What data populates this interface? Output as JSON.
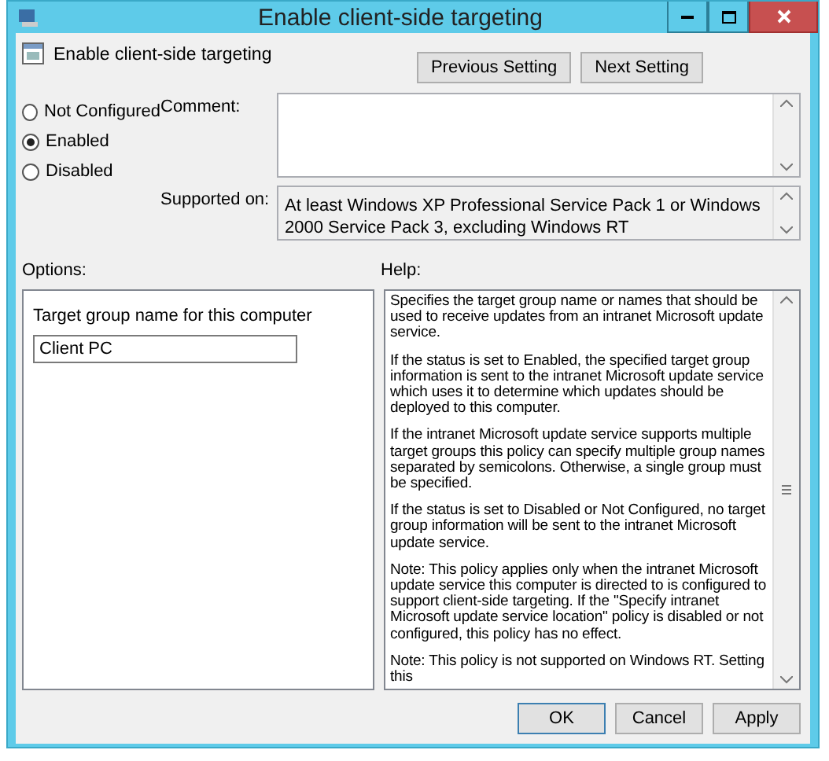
{
  "window": {
    "title": "Enable client-side targeting"
  },
  "header": {
    "title": "Enable client-side targeting",
    "buttons": [
      "Previous Setting",
      "Next Setting"
    ]
  },
  "states": [
    {
      "label": "Not Configured",
      "selected": false
    },
    {
      "label": "Enabled",
      "selected": true
    },
    {
      "label": "Disabled",
      "selected": false
    }
  ],
  "comment": {
    "label": "Comment:"
  },
  "supported_on": {
    "label": "Supported on:",
    "value": "At least Windows XP Professional Service Pack 1 or Windows 2000 Service Pack 3, excluding Windows RT"
  },
  "options": {
    "label": "Options:",
    "field_label": "Target group name for this computer",
    "field_value": "Client PC"
  },
  "help": {
    "label": "Help:",
    "paragraphs": [
      "Specifies the target group name or names that should be used to receive updates from an intranet Microsoft update service.",
      "If the status is set to Enabled, the specified target group information is sent to the intranet Microsoft update service which uses it to determine which updates should be deployed to this computer.",
      "If the intranet Microsoft update service supports multiple target groups this policy can specify multiple group names separated by semicolons. Otherwise, a single group must be specified.",
      "If the status is set to Disabled or Not Configured, no target group information will be sent to the intranet Microsoft update service.",
      "Note: This policy applies only when the intranet Microsoft update service this computer is directed to is configured to support client-side targeting. If the \"Specify intranet Microsoft update service location\" policy is disabled or not configured, this policy has no effect.",
      "Note: This policy is not supported on Windows RT. Setting this"
    ]
  },
  "buttons": [
    "OK",
    "Cancel",
    "Apply"
  ]
}
